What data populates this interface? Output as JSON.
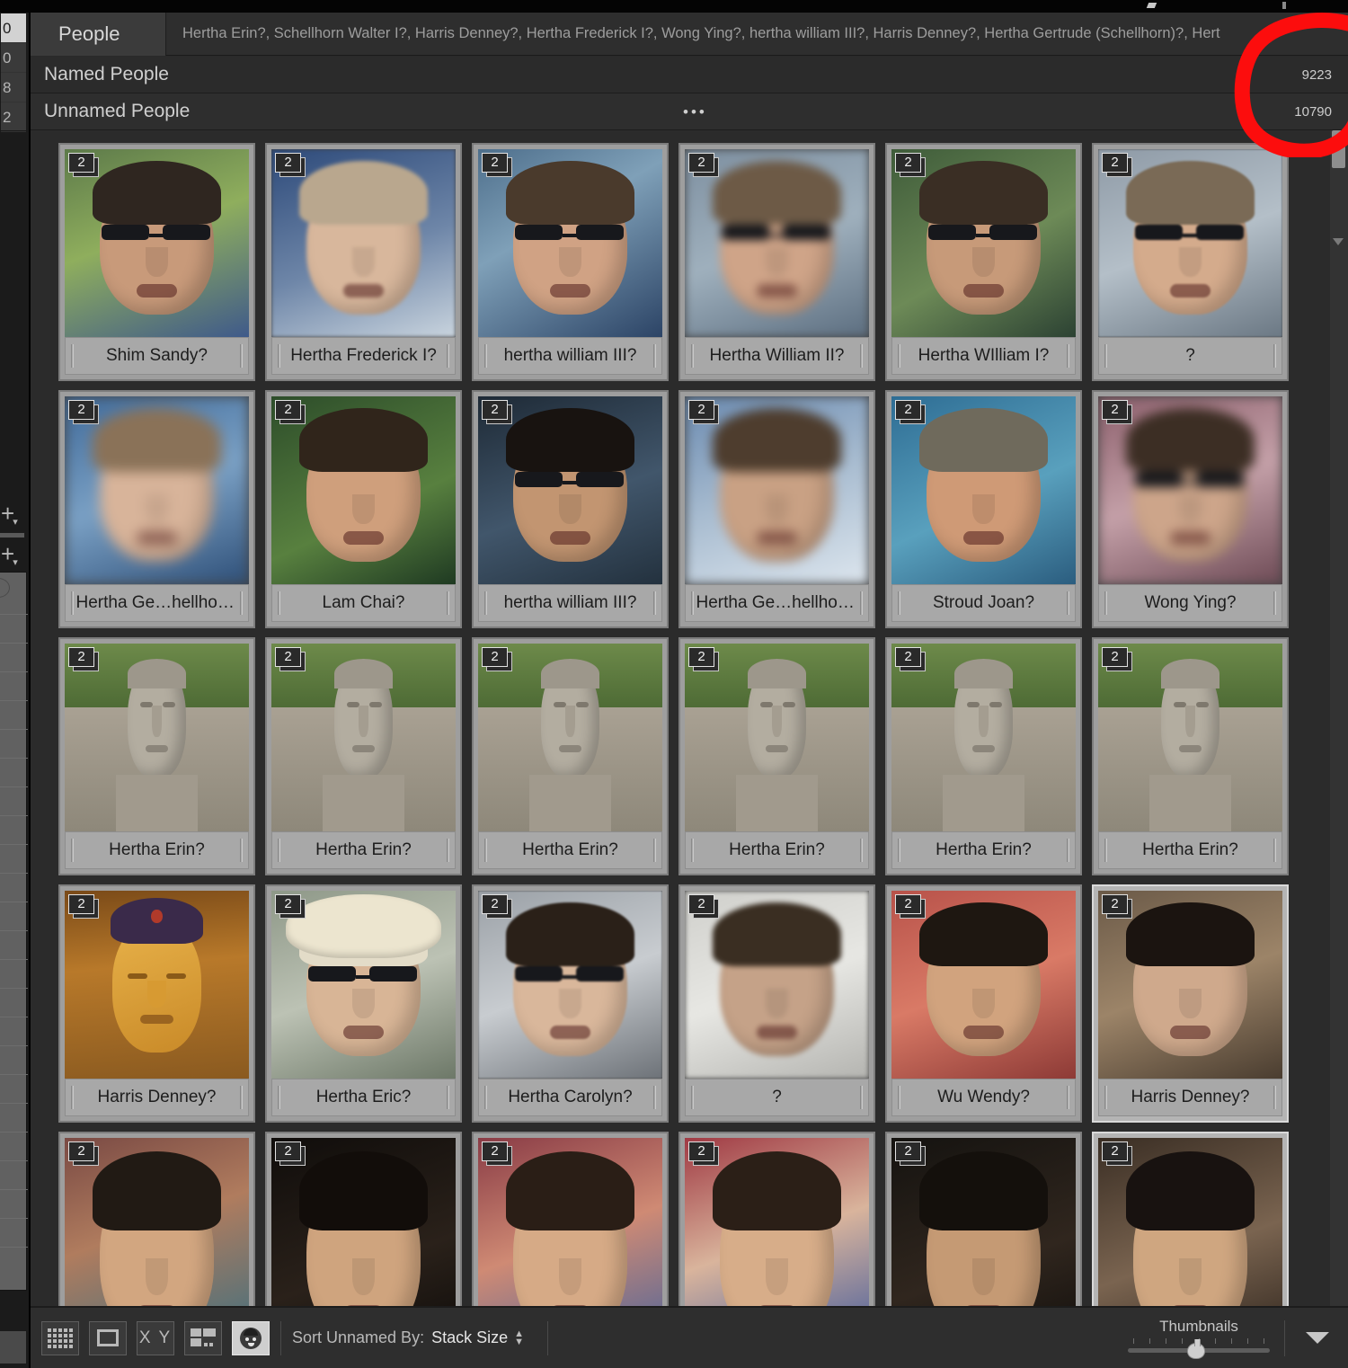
{
  "header": {
    "tab_label": "People",
    "breadcrumb": "Hertha Erin?,  Schellhorn Walter I?,  Harris Denney?,  Hertha Frederick I?,  Wong Ying?,  hertha william III?,  Harris Denney?,  Hertha Gertrude (Schellhorn)?,  Hert"
  },
  "sections": {
    "named": {
      "label": "Named People",
      "count": "9223"
    },
    "unnamed": {
      "label": "Unnamed People",
      "count": "10790",
      "ellipsis": "•••"
    }
  },
  "left_panel": {
    "list_rows": [
      "0",
      "0",
      "8",
      "2"
    ],
    "plus_glyph": "+",
    "chevron_glyph": "▾"
  },
  "grid": {
    "stack_badge": "2",
    "rows": [
      [
        {
          "label": "Shim Sandy?",
          "badge": "2",
          "selected": false
        },
        {
          "label": "Hertha Frederick I?",
          "badge": "2",
          "selected": false
        },
        {
          "label": "hertha william III?",
          "badge": "2",
          "selected": false
        },
        {
          "label": "Hertha William II?",
          "badge": "2",
          "selected": false
        },
        {
          "label": "Hertha WIlliam I?",
          "badge": "2",
          "selected": false
        },
        {
          "label": "?",
          "badge": "2",
          "selected": false
        }
      ],
      [
        {
          "label": "Hertha Ge…hellhorn)?",
          "badge": "2",
          "selected": false
        },
        {
          "label": "Lam Chai?",
          "badge": "2",
          "selected": false
        },
        {
          "label": "hertha william III?",
          "badge": "2",
          "selected": false
        },
        {
          "label": "Hertha Ge…hellhorn)?",
          "badge": "2",
          "selected": false
        },
        {
          "label": "Stroud Joan?",
          "badge": "2",
          "selected": false
        },
        {
          "label": "Wong Ying?",
          "badge": "2",
          "selected": false
        }
      ],
      [
        {
          "label": "Hertha Erin?",
          "badge": "2",
          "selected": false
        },
        {
          "label": "Hertha Erin?",
          "badge": "2",
          "selected": false
        },
        {
          "label": "Hertha Erin?",
          "badge": "2",
          "selected": false
        },
        {
          "label": "Hertha Erin?",
          "badge": "2",
          "selected": false
        },
        {
          "label": "Hertha Erin?",
          "badge": "2",
          "selected": false
        },
        {
          "label": "Hertha Erin?",
          "badge": "2",
          "selected": false
        }
      ],
      [
        {
          "label": "Harris Denney?",
          "badge": "2",
          "selected": false
        },
        {
          "label": "Hertha Eric?",
          "badge": "2",
          "selected": false
        },
        {
          "label": "Hertha Carolyn?",
          "badge": "2",
          "selected": false
        },
        {
          "label": "?",
          "badge": "2",
          "selected": false
        },
        {
          "label": "Wu Wendy?",
          "badge": "2",
          "selected": false
        },
        {
          "label": "Harris Denney?",
          "badge": "2",
          "selected": true
        }
      ],
      [
        {
          "label": "",
          "badge": "2",
          "selected": false
        },
        {
          "label": "",
          "badge": "2",
          "selected": false
        },
        {
          "label": "",
          "badge": "2",
          "selected": false
        },
        {
          "label": "",
          "badge": "2",
          "selected": false
        },
        {
          "label": "",
          "badge": "2",
          "selected": false
        },
        {
          "label": "",
          "badge": "2",
          "selected": true
        }
      ]
    ]
  },
  "toolbar": {
    "view_buttons": [
      {
        "name": "grid-view",
        "glyph": ""
      },
      {
        "name": "loupe-view",
        "glyph": ""
      },
      {
        "name": "compare-view",
        "glyph": "X Y"
      },
      {
        "name": "survey-view",
        "glyph": ""
      },
      {
        "name": "people-view",
        "glyph": ""
      }
    ],
    "sort_label": "Sort Unnamed By:",
    "sort_value": "Stack Size",
    "thumbnails_label": "Thumbnails"
  },
  "annotation": {
    "color": "#fc0d0d",
    "shape": "hand-drawn-circle"
  }
}
